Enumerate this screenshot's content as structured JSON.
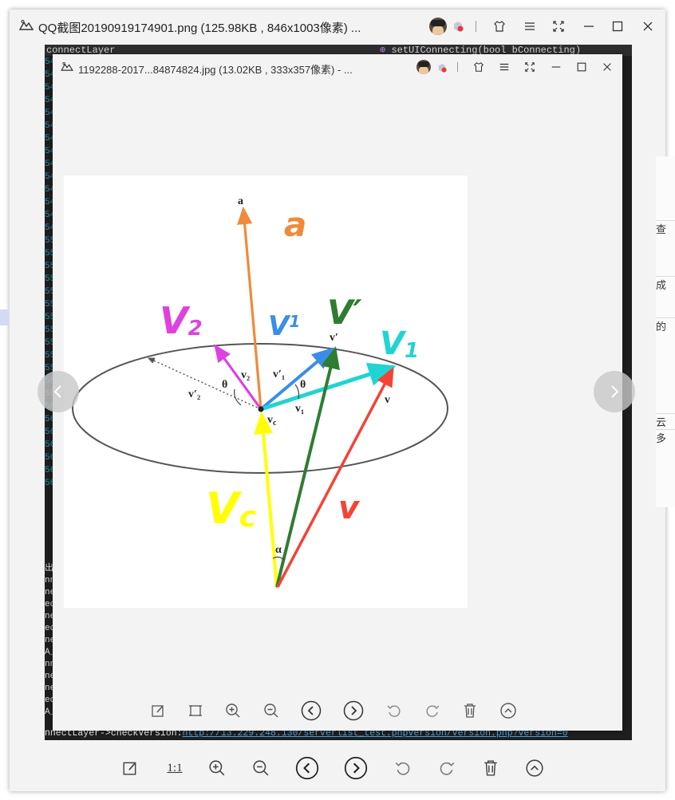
{
  "outer_window": {
    "title": "QQ截图20190919174901.png (125.98KB , 846x1003像素) ..."
  },
  "inner_window": {
    "title": "1192288-2017...84874824.jpg (13.02KB , 333x357像素) - ..."
  },
  "code_editor": {
    "header_left": "connectLayer",
    "header_right": "setUIConnecting(bool bConnecting)",
    "footer_prefix": "nnectLayer->checkVersion:",
    "footer_link": "http://13.229.248.130/serverlist_test.phpversion/version.php?version=0",
    "gutter_lines": [
      "54",
      "54",
      "54",
      "54",
      "54",
      "54",
      "54",
      "54",
      "54",
      "54",
      "54",
      "54",
      "54",
      "54",
      "55",
      "55",
      "55",
      "55",
      "55",
      "55",
      "55",
      "55",
      "55",
      "55",
      "55",
      "55",
      "56",
      "56",
      "56",
      "56",
      "56",
      "56",
      "56",
      "56"
    ],
    "console_lines": [
      "出",
      "nn",
      "ne",
      "ec",
      "ne",
      "ec",
      "ne",
      "A_",
      "nn",
      "ne",
      "ne",
      "ec",
      "A_"
    ]
  },
  "right_strip": [
    "查",
    "成",
    "的",
    "云",
    "多"
  ],
  "figure": {
    "labels": {
      "a": "a",
      "v2_prime": "v′₂",
      "v2": "v₂",
      "theta_left": "θ",
      "v1_prime": "v′₁",
      "theta_right": "θ",
      "v1": "v₁",
      "vc": "v",
      "vc_sub": "c",
      "v": "v",
      "v_prime": "v′",
      "alpha": "α"
    },
    "handwritten": {
      "a": "a",
      "v2": "V",
      "v2_sub": "2",
      "v1_prime": "V",
      "v1_prime_sub": "1",
      "v_prime": "V′",
      "v1": "V",
      "v1_sub": "1",
      "vc": "V",
      "vc_sub": "c",
      "v": "v"
    },
    "colors": {
      "a": "#f08a3a",
      "v2": "#e040e0",
      "v1_prime": "#3a8ee6",
      "v_prime": "#2e7d32",
      "v1": "#22d3d3",
      "vc": "#ffff00",
      "v": "#f44336"
    }
  },
  "toolbar": {
    "ratio_label": "1:1"
  },
  "icons": [
    "edit-icon",
    "fit-icon",
    "zoom-in-icon",
    "zoom-out-icon",
    "prev-icon",
    "next-icon",
    "rotate-left-icon",
    "rotate-right-icon",
    "delete-icon",
    "more-icon"
  ]
}
